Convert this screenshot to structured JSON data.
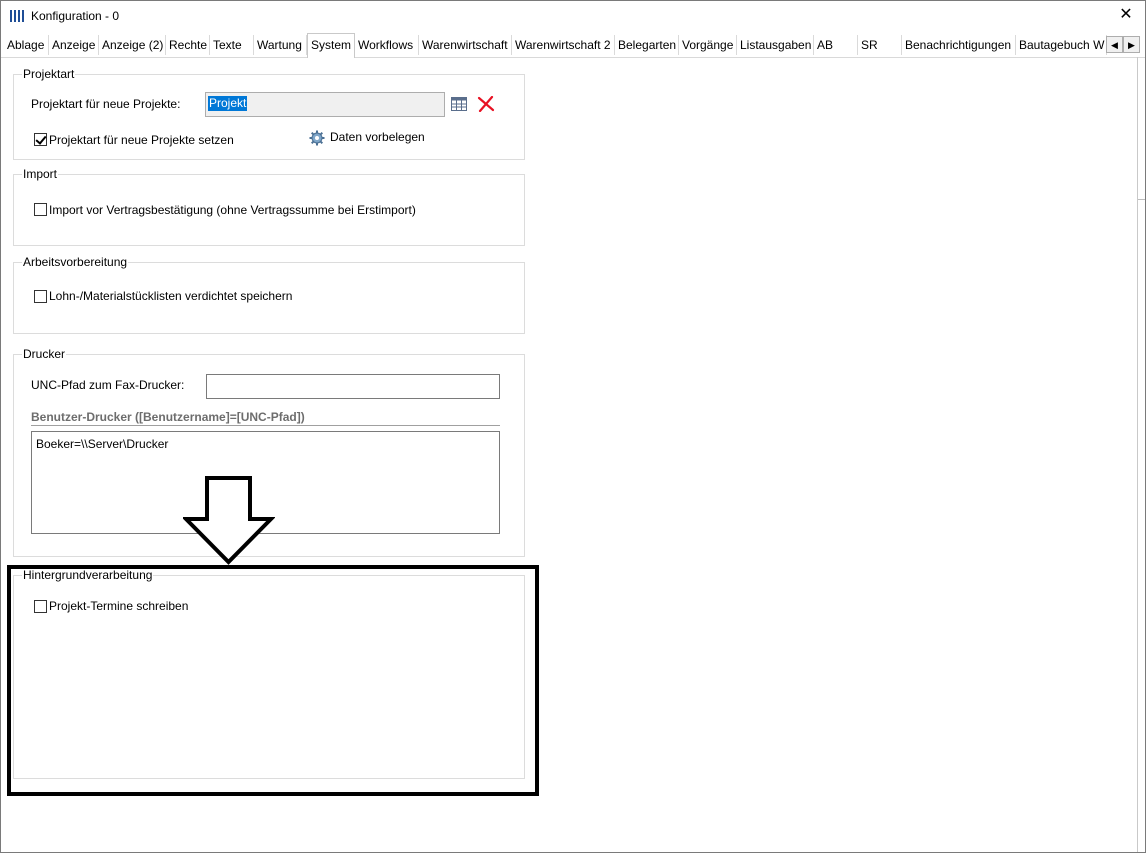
{
  "window": {
    "title": "Konfiguration - 0",
    "close_glyph": "✕"
  },
  "tabs": [
    {
      "label": "Ablage"
    },
    {
      "label": "Anzeige"
    },
    {
      "label": "Anzeige (2)"
    },
    {
      "label": "Rechte"
    },
    {
      "label": "Texte"
    },
    {
      "label": "Wartung"
    },
    {
      "label": "System",
      "active": true
    },
    {
      "label": "Workflows"
    },
    {
      "label": "Warenwirtschaft"
    },
    {
      "label": "Warenwirtschaft 2"
    },
    {
      "label": "Belegarten"
    },
    {
      "label": "Vorgänge"
    },
    {
      "label": "Listausgaben"
    },
    {
      "label": "AB"
    },
    {
      "label": "SR"
    },
    {
      "label": "Benachrichtigungen"
    },
    {
      "label": "Bautagebuch W"
    }
  ],
  "tab_scroll": {
    "left": "◀",
    "right": "▶"
  },
  "projektart": {
    "title": "Projektart",
    "label": "Projektart für neue Projekte:",
    "value": "Projekt",
    "checkbox_label": "Projektart für neue Projekte setzen",
    "checkbox_checked": true,
    "prefill_button": "Daten vorbelegen"
  },
  "import": {
    "title": "Import",
    "checkbox_label": "Import vor Vertragsbestätigung (ohne Vertragssumme bei Erstimport)",
    "checkbox_checked": false
  },
  "arbeitsvorbereitung": {
    "title": "Arbeitsvorbereitung",
    "checkbox_label": "Lohn-/Materialstücklisten verdichtet speichern",
    "checkbox_checked": false
  },
  "drucker": {
    "title": "Drucker",
    "fax_label": "UNC-Pfad zum Fax-Drucker:",
    "fax_value": "",
    "user_printers_header": "Benutzer-Drucker ([Benutzername]=[UNC-Pfad])",
    "user_printers_value": "Boeker=\\\\Server\\Drucker"
  },
  "hintergrund": {
    "title": "Hintergrundverarbeitung",
    "checkbox_label": "Projekt-Termine schreiben",
    "checkbox_checked": false
  },
  "colors": {
    "accent": "#0078d7",
    "delete_red": "#e81123",
    "app_icon": "#1f4e96"
  }
}
